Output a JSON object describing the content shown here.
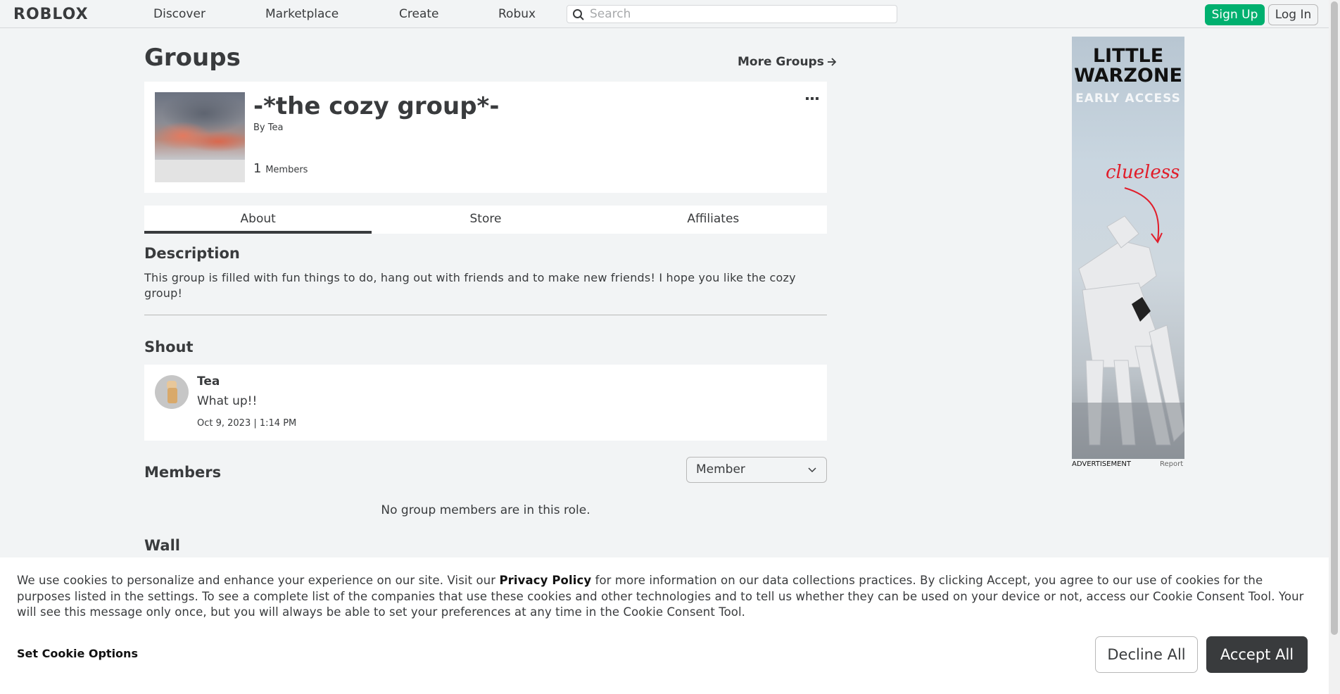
{
  "nav": {
    "logo": "ROBLOX",
    "links": [
      "Discover",
      "Marketplace",
      "Create",
      "Robux"
    ],
    "search_placeholder": "Search",
    "signup_label": "Sign Up",
    "login_label": "Log In"
  },
  "page": {
    "title": "Groups",
    "more_groups": "More Groups"
  },
  "group": {
    "name": "-*the cozy group*-",
    "by_prefix": "By",
    "owner": "Tea",
    "member_count": "1",
    "members_label": "Members",
    "more_icon": "more-dots-icon"
  },
  "tabs": [
    "About",
    "Store",
    "Affiliates"
  ],
  "active_tab": "About",
  "about": {
    "description_heading": "Description",
    "description": "This group is filled with fun things to do, hang out with friends and to make new friends! I hope you like the cozy group!",
    "shout_heading": "Shout",
    "shout": {
      "author": "Tea",
      "text": "What up!!",
      "date": "Oct 9, 2023 | 1:14 PM"
    },
    "members_heading": "Members",
    "role_selected": "Member",
    "no_members": "No group members are in this role.",
    "wall_heading": "Wall"
  },
  "ad": {
    "line1": "LITTLE",
    "line2": "WARZONE",
    "line3": "EARLY ACCESS",
    "tagline": "clueless",
    "label": "ADVERTISEMENT",
    "report": "Report"
  },
  "cookie": {
    "text_before": "We use cookies to personalize and enhance your experience on our site. Visit our ",
    "privacy_link": "Privacy Policy",
    "text_after": " for more information on our data collections practices. By clicking Accept, you agree to our use of cookies for the purposes listed in the settings. To see a complete list of the companies that use these cookies and other technologies and to tell us whether they can be used on your device or not, access our Cookie Consent Tool. Your will see this message only once, but you will always be able to set your preferences at any time in the Cookie Consent Tool.",
    "set_options": "Set Cookie Options",
    "decline": "Decline All",
    "accept": "Accept All"
  },
  "colors": {
    "background": "#f2f4f5",
    "card": "#ffffff",
    "text": "#393b3d",
    "signup_green": "#00b06f",
    "accept_dark": "#393b3d",
    "ad_red": "#e11d2a"
  }
}
